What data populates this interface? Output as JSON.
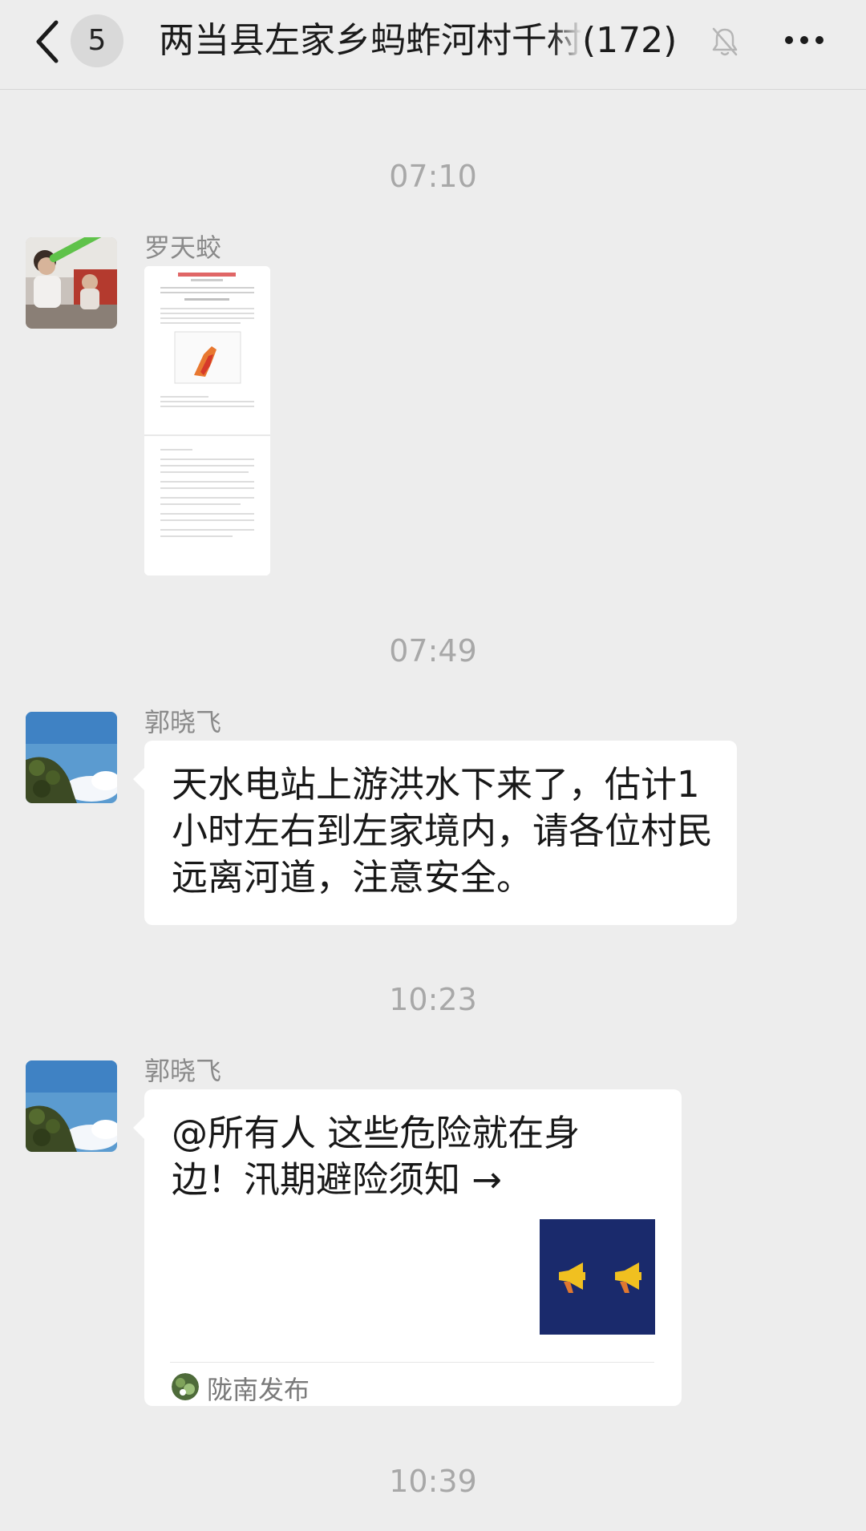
{
  "header": {
    "badge_count": "5",
    "group_name": "两当县左家乡蚂蚱河村千村",
    "member_count": "(172)"
  },
  "messages": [
    {
      "time": "07:10",
      "sender": "罗天蛟",
      "type": "document"
    },
    {
      "time": "07:49",
      "sender": "郭晓飞",
      "type": "text",
      "text": "天水电站上游洪水下来了，估计1小时左右到左家境内，请各位村民远离河道，注意安全。"
    },
    {
      "time": "10:23",
      "sender": "郭晓飞",
      "type": "link-card",
      "title": "@所有人 这些危险就在身边！汛期避险须知 →",
      "source": "陇南发布"
    }
  ],
  "trailing_time": "10:39",
  "colors": {
    "background": "#ededed",
    "bubble": "#ffffff",
    "thumb": "#1a2a6c",
    "megaphone": "#f0c020"
  },
  "icons": [
    "back-chevron-icon",
    "bell-muted-icon",
    "more-dots-icon",
    "megaphone-icon"
  ]
}
